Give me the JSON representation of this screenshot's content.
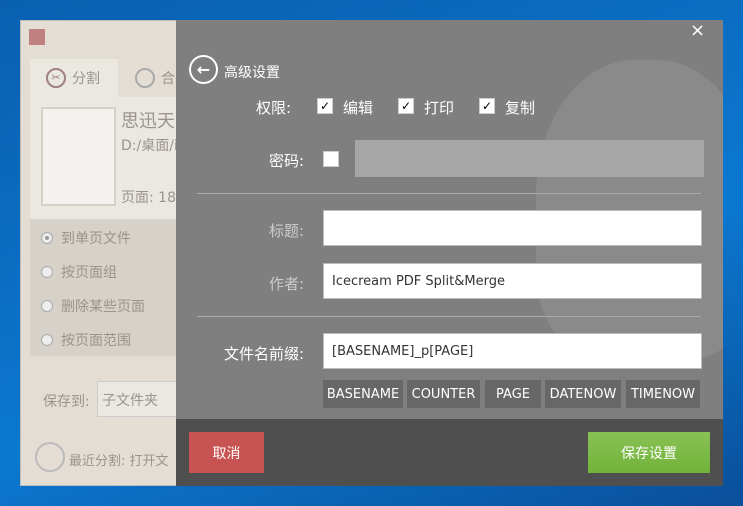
{
  "background_app": {
    "tabs": [
      {
        "label": "分割",
        "icon": "scissors-icon"
      },
      {
        "label": "合并",
        "icon": "merge-icon"
      }
    ],
    "file_title": "思迅天",
    "file_path": "D:/桌面/i",
    "pages_label": "页面: 18",
    "split_options": [
      "到单页文件",
      "按页面组",
      "删除某些页面",
      "按页面范围"
    ],
    "save_to_label": "保存到:",
    "save_to_value": "子文件夹",
    "recent_label": "最近分割: 打开文"
  },
  "dialog": {
    "title": "高级设置",
    "permissions_label": "权限:",
    "permissions": [
      {
        "label": "编辑",
        "checked": true
      },
      {
        "label": "打印",
        "checked": true
      },
      {
        "label": "复制",
        "checked": true
      }
    ],
    "password_label": "密码:",
    "password_checked": false,
    "title_label": "标题:",
    "title_value": "",
    "author_label": "作者:",
    "author_value": "Icecream PDF Split&Merge",
    "prefix_label": "文件名前缀:",
    "prefix_value": "[BASENAME]_p[PAGE]",
    "tags": [
      "BASENAME",
      "COUNTER",
      "PAGE",
      "DATENOW",
      "TIMENOW"
    ],
    "cancel_label": "取消",
    "save_label": "保存设置",
    "close_label": "×"
  },
  "colors": {
    "cancel": "#c75353",
    "save": "#7ab846",
    "panel": "#7f7f7f",
    "footer": "#4f4f4f"
  }
}
